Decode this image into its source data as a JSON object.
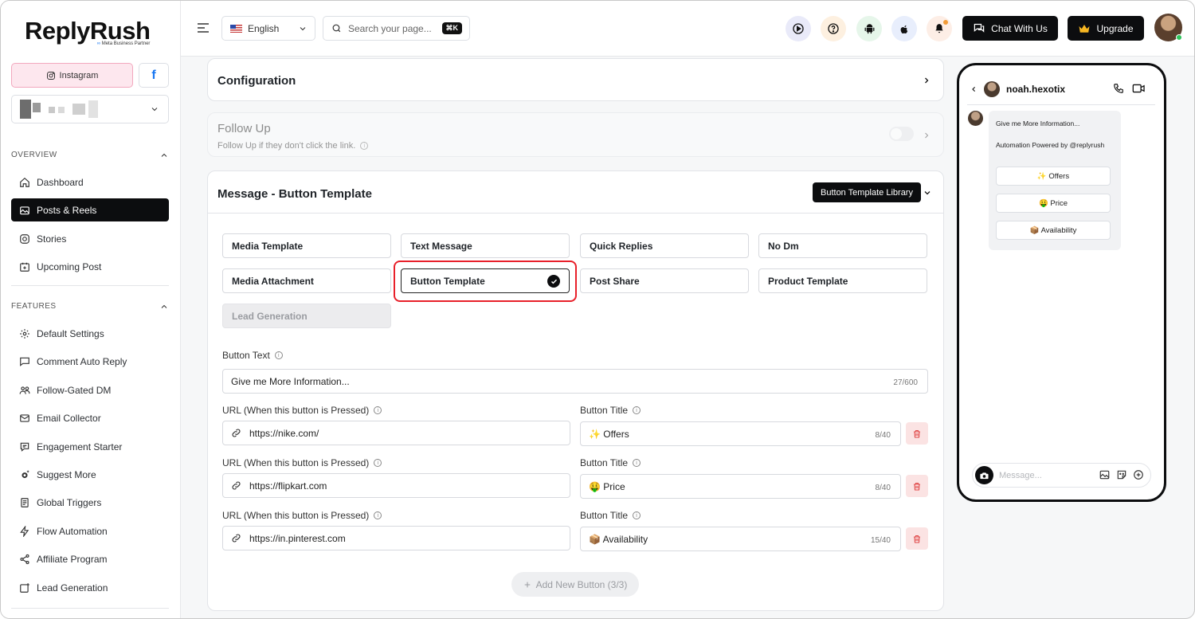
{
  "brand": {
    "name": "ReplyRush",
    "partner": "Meta Business Partner"
  },
  "sidebar": {
    "instagram_label": "Instagram",
    "facebook_label": "f",
    "overview_label": "OVERVIEW",
    "features_label": "FEATURES",
    "overview_items": [
      {
        "label": "Dashboard",
        "icon": "home-icon"
      },
      {
        "label": "Posts & Reels",
        "icon": "image-icon",
        "active": true
      },
      {
        "label": "Stories",
        "icon": "stories-icon"
      },
      {
        "label": "Upcoming Post",
        "icon": "calendar-plus-icon"
      }
    ],
    "feature_items": [
      {
        "label": "Default Settings",
        "icon": "gear-icon"
      },
      {
        "label": "Comment Auto Reply",
        "icon": "comment-icon"
      },
      {
        "label": "Follow-Gated DM",
        "icon": "users-icon"
      },
      {
        "label": "Email Collector",
        "icon": "mail-icon"
      },
      {
        "label": "Engagement Starter",
        "icon": "chat-icon"
      },
      {
        "label": "Suggest More",
        "icon": "sparkle-gear-icon"
      },
      {
        "label": "Global Triggers",
        "icon": "document-icon"
      },
      {
        "label": "Flow Automation",
        "icon": "bolt-icon"
      },
      {
        "label": "Affiliate Program",
        "icon": "share-icon"
      },
      {
        "label": "Lead Generation",
        "icon": "lead-icon"
      }
    ]
  },
  "topbar": {
    "language": "English",
    "search_placeholder": "Search your page...",
    "search_shortcut": "⌘K",
    "chat_label": "Chat With Us",
    "upgrade_label": "Upgrade",
    "icon_colors": {
      "play": "#e9eaf9",
      "help": "#fdf0e0",
      "android": "#e6f6ea",
      "apple": "#e8eefc",
      "bell": "#fdeee6"
    }
  },
  "main": {
    "configuration_title": "Configuration",
    "follow_up_title": "Follow Up",
    "follow_up_subtitle": "Follow Up if they don't click the link.",
    "message_title": "Message - Button Template",
    "library_button": "Button Template Library",
    "templates": [
      "Media Template",
      "Text Message",
      "Quick Replies",
      "No Dm",
      "Media Attachment",
      "Button Template",
      "Post Share",
      "Product Template",
      "Lead Generation"
    ],
    "selected_template": "Button Template",
    "button_text_label": "Button Text",
    "button_text_value": "Give me More Information...",
    "button_text_counter": "27/600",
    "url_label": "URL (When this button is Pressed)",
    "title_label": "Button Title",
    "buttons": [
      {
        "url": "https://nike.com/",
        "title": "✨ Offers",
        "counter": "8/40"
      },
      {
        "url": "https://flipkart.com",
        "title": "🤑 Price",
        "counter": "8/40"
      },
      {
        "url": "https://in.pinterest.com",
        "title": "📦 Availability",
        "counter": "15/40"
      }
    ],
    "add_button_label": "Add New Button (3/3)"
  },
  "preview": {
    "username": "noah.hexotix",
    "message": "Give me More Information...",
    "powered": "Automation Powered by @replyrush",
    "quick_buttons": [
      "✨ Offers",
      "🤑 Price",
      "📦 Availability"
    ],
    "input_placeholder": "Message..."
  }
}
